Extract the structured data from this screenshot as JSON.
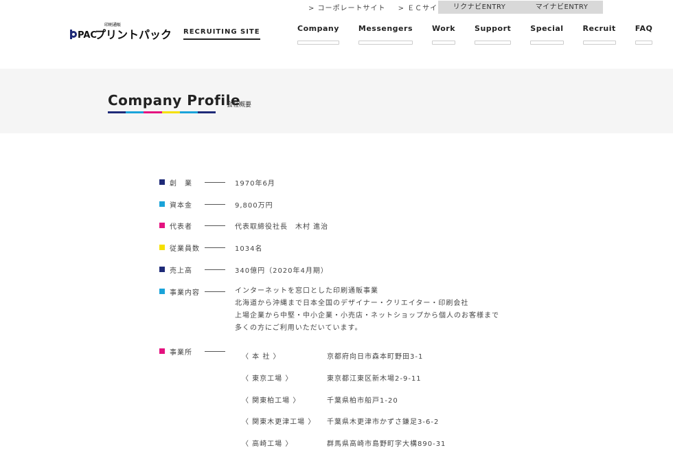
{
  "header": {
    "utility_links": [
      "> コーポレートサイト",
      "> ＥＣサイト"
    ],
    "entry_buttons": [
      "リクナビENTRY",
      "マイナビENTRY"
    ],
    "logo_small": "印刷通販",
    "logo_text": "プリントパック",
    "logo_mark": "PAC",
    "recruiting_label": "RECRUITING SITE",
    "nav": [
      "Company",
      "Messengers",
      "Work",
      "Support",
      "Special",
      "Recruit",
      "FAQ"
    ]
  },
  "page": {
    "title": "Company Profile",
    "subtitle": "会社概要"
  },
  "colors": {
    "navy": "#1e2a78",
    "cyan": "#1aa3d9",
    "magenta": "#e4127f",
    "yellow": "#f5e000"
  },
  "profile": [
    {
      "label": "創　業",
      "value": "1970年6月",
      "color": "navy"
    },
    {
      "label": "資本金",
      "value": "9,800万円",
      "color": "cyan"
    },
    {
      "label": "代表者",
      "value": "代表取締役社長　木村 進治",
      "color": "magenta"
    },
    {
      "label": "従業員数",
      "value": "1034名",
      "color": "yellow"
    },
    {
      "label": "売上高",
      "value": "340億円（2020年4月期）",
      "color": "navy"
    },
    {
      "label": "事業内容",
      "value_lines": [
        "インターネットを窓口とした印刷通販事業",
        "北海道から沖縄まで日本全国のデザイナー・クリエイター・印刷会社",
        "上場企業から中堅・中小企業・小売店・ネットショップから個人のお客様まで",
        "多くの方にご利用いただいています。"
      ],
      "color": "cyan"
    },
    {
      "label": "事業所",
      "color": "magenta"
    }
  ],
  "offices": [
    {
      "name": "〈 本 社 〉",
      "address": "京都府向日市森本町野田3-1"
    },
    {
      "name": "〈 東京工場 〉",
      "address": "東京都江東区新木場2-9-11"
    },
    {
      "name": "〈 関東柏工場 〉",
      "address": "千葉県柏市船戸1-20"
    },
    {
      "name": "〈 関東木更津工場 〉",
      "address": "千葉県木更津市かずさ鎌足3-6-2"
    },
    {
      "name": "〈 高崎工場 〉",
      "address": "群馬県高崎市島野町字大構890-31"
    }
  ]
}
